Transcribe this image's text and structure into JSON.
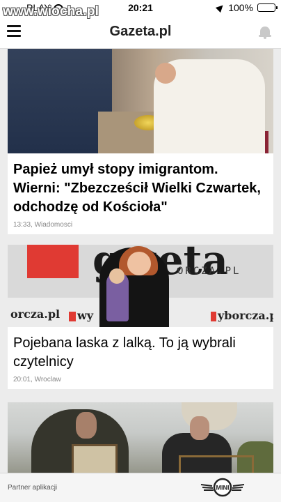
{
  "watermark": "www.wiocha.pl",
  "status": {
    "carrier": "PLAY",
    "time": "20:21",
    "battery": "100%",
    "battery_level": 1.0
  },
  "app": {
    "title": "Gazeta.pl"
  },
  "articles": [
    {
      "headline": "Papież umył stopy imigrantom. Wierni: \"Zbezcześcił Wielki Czwartek, odchodzę od Kościoła\"",
      "meta": "13:33, Wiadomosci"
    },
    {
      "headline": "Pojebana laska z lalką. To ją wybrali czytelnicy",
      "meta": "20:01, Wroclaw",
      "image_text": {
        "top": "g  zeta",
        "orcza": "ORCZA.PL",
        "left": "orcza.pl",
        "mid": "wy",
        "right": "yborcza.pl"
      }
    }
  ],
  "footer": {
    "partner_label": "Partner aplikacji",
    "logo_text": "MINI"
  }
}
